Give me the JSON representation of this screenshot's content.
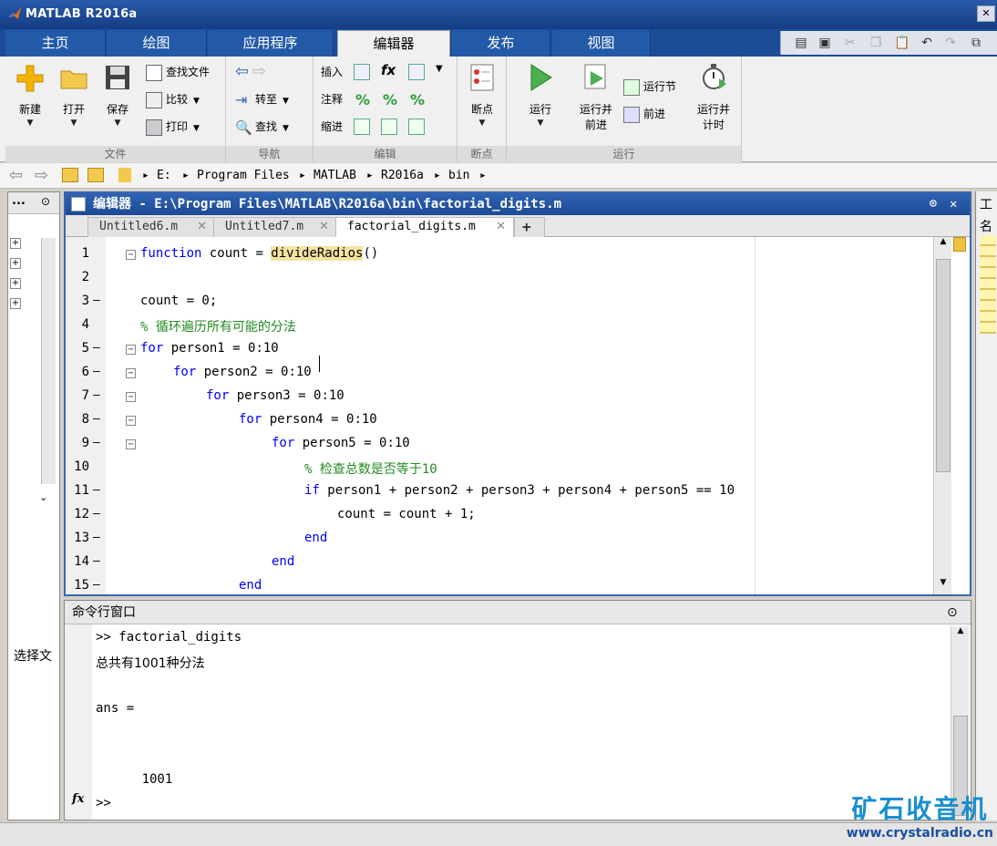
{
  "window": {
    "title": "MATLAB R2016a"
  },
  "ribbon_tabs": [
    "主页",
    "绘图",
    "应用程序",
    "编辑器",
    "发布",
    "视图"
  ],
  "active_tab": "编辑器",
  "ribbon": {
    "file": {
      "label": "文件",
      "new": "新建",
      "open": "打开",
      "save": "保存",
      "find_files": "查找文件",
      "compare": "比较",
      "print": "打印"
    },
    "nav": {
      "label": "导航",
      "goto": "转至",
      "find": "查找"
    },
    "edit": {
      "label": "编辑",
      "insert": "插入",
      "comment": "注释",
      "indent": "缩进"
    },
    "breakpoints": {
      "label": "断点",
      "button": "断点"
    },
    "run": {
      "label": "运行",
      "run": "运行",
      "run_advance_l1": "运行并",
      "run_advance_l2": "前进",
      "run_section": "运行节",
      "advance": "前进",
      "run_time_l1": "运行并",
      "run_time_l2": "计时"
    }
  },
  "address": {
    "path": [
      "E:",
      "Program Files",
      "MATLAB",
      "R2016a",
      "bin"
    ]
  },
  "left_panel": {
    "dots": "...",
    "label": "选择文"
  },
  "right_panel": {
    "top": "工",
    "name": "名"
  },
  "editor": {
    "title": "编辑器 - E:\\Program Files\\MATLAB\\R2016a\\bin\\factorial_digits.m",
    "tabs": [
      "Untitled6.m",
      "Untitled7.m",
      "factorial_digits.m"
    ],
    "active_tab": "factorial_digits.m",
    "lines": [
      {
        "n": "1",
        "dash": false,
        "fold": true,
        "indent": 0,
        "parts": [
          {
            "c": "kw",
            "t": "function"
          },
          {
            "c": "",
            "t": " count = "
          },
          {
            "c": "hl",
            "t": "divideRadios"
          },
          {
            "c": "",
            "t": "()"
          }
        ]
      },
      {
        "n": "2",
        "dash": false,
        "fold": false,
        "indent": 0,
        "parts": []
      },
      {
        "n": "3",
        "dash": true,
        "fold": false,
        "indent": 0,
        "parts": [
          {
            "c": "",
            "t": "count = 0;"
          }
        ]
      },
      {
        "n": "4",
        "dash": false,
        "fold": false,
        "indent": 0,
        "parts": [
          {
            "c": "cm",
            "t": "% 循环遍历所有可能的分法"
          }
        ]
      },
      {
        "n": "5",
        "dash": true,
        "fold": true,
        "indent": 0,
        "parts": [
          {
            "c": "kw",
            "t": "for"
          },
          {
            "c": "",
            "t": " person1 = 0:10"
          }
        ]
      },
      {
        "n": "6",
        "dash": true,
        "fold": true,
        "indent": 1,
        "parts": [
          {
            "c": "kw",
            "t": "for"
          },
          {
            "c": "",
            "t": " person2 = 0:10"
          }
        ]
      },
      {
        "n": "7",
        "dash": true,
        "fold": true,
        "indent": 2,
        "parts": [
          {
            "c": "kw",
            "t": "for"
          },
          {
            "c": "",
            "t": " person3 = 0:10"
          }
        ]
      },
      {
        "n": "8",
        "dash": true,
        "fold": true,
        "indent": 3,
        "parts": [
          {
            "c": "kw",
            "t": "for"
          },
          {
            "c": "",
            "t": " person4 = 0:10"
          }
        ]
      },
      {
        "n": "9",
        "dash": true,
        "fold": true,
        "indent": 4,
        "parts": [
          {
            "c": "kw",
            "t": "for"
          },
          {
            "c": "",
            "t": " person5 = 0:10"
          }
        ]
      },
      {
        "n": "10",
        "dash": false,
        "fold": false,
        "indent": 5,
        "parts": [
          {
            "c": "cm",
            "t": "% 检查总数是否等于10"
          }
        ]
      },
      {
        "n": "11",
        "dash": true,
        "fold": false,
        "indent": 5,
        "parts": [
          {
            "c": "kw",
            "t": "if"
          },
          {
            "c": "",
            "t": " person1 + person2 + person3 + person4 + person5 == 10"
          }
        ]
      },
      {
        "n": "12",
        "dash": true,
        "fold": false,
        "indent": 6,
        "parts": [
          {
            "c": "",
            "t": "count = count + 1;"
          }
        ]
      },
      {
        "n": "13",
        "dash": true,
        "fold": false,
        "indent": 5,
        "parts": [
          {
            "c": "kw",
            "t": "end"
          }
        ]
      },
      {
        "n": "14",
        "dash": true,
        "fold": false,
        "indent": 4,
        "parts": [
          {
            "c": "kw",
            "t": "end"
          }
        ]
      },
      {
        "n": "15",
        "dash": true,
        "fold": false,
        "indent": 3,
        "parts": [
          {
            "c": "kw",
            "t": "end"
          }
        ]
      }
    ]
  },
  "command_window": {
    "title": "命令行窗口",
    "lines": [
      ">> factorial_digits",
      "总共有1001种分法",
      "",
      "ans =",
      "",
      "",
      "      1001"
    ],
    "prompt": ">>",
    "fx": "fx"
  },
  "watermark": {
    "line1": "矿石收音机",
    "line2": "www.crystalradio.cn"
  },
  "colors": {
    "accent": "#1d4a93",
    "keyword": "#0000ff",
    "comment": "#228b22",
    "highlight": "#f5e3a0"
  }
}
